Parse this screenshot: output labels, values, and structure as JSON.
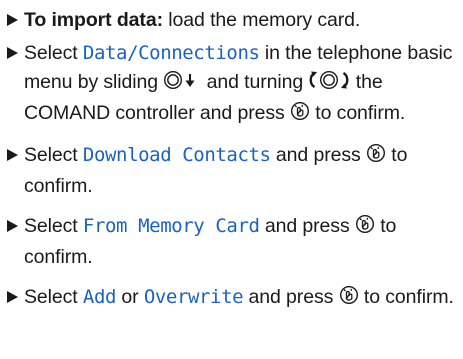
{
  "steps": [
    {
      "lead": "To import data:",
      "rest": " load the memory card."
    },
    {
      "t1": "Select ",
      "menu": "Data/Connections",
      "t2": " in the telephone basic menu by sliding ",
      "t3": " and turning ",
      "t4": " the COMAND controller and press ",
      "t5": " to confirm."
    },
    {
      "t1": "Select ",
      "menu": "Download Contacts",
      "t2": " and press ",
      "t3": " to confirm."
    },
    {
      "t1": "Select ",
      "menu": "From Memory Card",
      "t2": " and press ",
      "t3": " to confirm."
    },
    {
      "t1": "Select ",
      "menu1": "Add",
      "t2": " or ",
      "menu2": "Overwrite",
      "t3": " and press ",
      "t4": " to confirm."
    }
  ],
  "icons": {
    "bullet": "triangle-bullet-icon",
    "slide_down": "controller-slide-down-icon",
    "turn": "controller-turn-icon",
    "press": "controller-press-icon"
  },
  "colors": {
    "menu_text": "#1a63c0",
    "body_text": "#1a1a1a"
  }
}
